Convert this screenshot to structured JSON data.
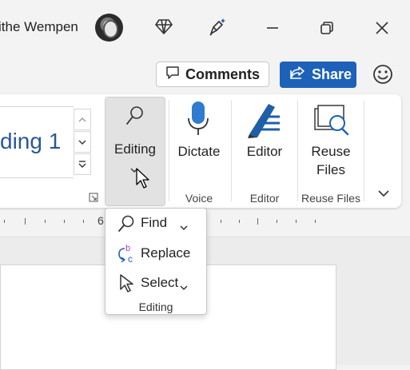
{
  "titlebar": {
    "user_name": "ithe Wempen"
  },
  "top_row": {
    "comments_label": "Comments",
    "share_label": "Share"
  },
  "ribbon": {
    "style_name": "ding 1",
    "editing_label": "Editing",
    "dictate_label": "Dictate",
    "editor_label": "Editor",
    "reuse_files_label_line1": "Reuse",
    "reuse_files_label_line2": "Files",
    "groups": {
      "voice": "Voice",
      "editor": "Editor",
      "reuse_files": "Reuse Files"
    }
  },
  "ruler": {
    "number": "6"
  },
  "editing_menu": {
    "items": [
      {
        "label": "Find",
        "icon": "search-icon",
        "has_chevron": true
      },
      {
        "label": "Replace",
        "icon": "replace-icon",
        "has_chevron": false
      },
      {
        "label": "Select",
        "icon": "select-pointer-icon",
        "has_chevron": true
      }
    ],
    "caption": "Editing"
  },
  "colors": {
    "accent_blue": "#1e61b8",
    "style_text": "#2b579a",
    "dictate_blue": "#2e7bcf",
    "editor_blue": "#1f5ea8"
  }
}
